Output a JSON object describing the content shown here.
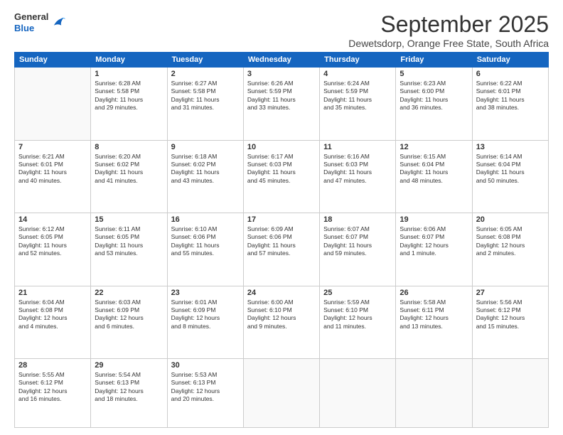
{
  "logo": {
    "general": "General",
    "blue": "Blue"
  },
  "title": "September 2025",
  "subtitle": "Dewetsdorp, Orange Free State, South Africa",
  "weekdays": [
    "Sunday",
    "Monday",
    "Tuesday",
    "Wednesday",
    "Thursday",
    "Friday",
    "Saturday"
  ],
  "weeks": [
    [
      {
        "day": "",
        "text": ""
      },
      {
        "day": "1",
        "text": "Sunrise: 6:28 AM\nSunset: 5:58 PM\nDaylight: 11 hours\nand 29 minutes."
      },
      {
        "day": "2",
        "text": "Sunrise: 6:27 AM\nSunset: 5:58 PM\nDaylight: 11 hours\nand 31 minutes."
      },
      {
        "day": "3",
        "text": "Sunrise: 6:26 AM\nSunset: 5:59 PM\nDaylight: 11 hours\nand 33 minutes."
      },
      {
        "day": "4",
        "text": "Sunrise: 6:24 AM\nSunset: 5:59 PM\nDaylight: 11 hours\nand 35 minutes."
      },
      {
        "day": "5",
        "text": "Sunrise: 6:23 AM\nSunset: 6:00 PM\nDaylight: 11 hours\nand 36 minutes."
      },
      {
        "day": "6",
        "text": "Sunrise: 6:22 AM\nSunset: 6:01 PM\nDaylight: 11 hours\nand 38 minutes."
      }
    ],
    [
      {
        "day": "7",
        "text": "Sunrise: 6:21 AM\nSunset: 6:01 PM\nDaylight: 11 hours\nand 40 minutes."
      },
      {
        "day": "8",
        "text": "Sunrise: 6:20 AM\nSunset: 6:02 PM\nDaylight: 11 hours\nand 41 minutes."
      },
      {
        "day": "9",
        "text": "Sunrise: 6:18 AM\nSunset: 6:02 PM\nDaylight: 11 hours\nand 43 minutes."
      },
      {
        "day": "10",
        "text": "Sunrise: 6:17 AM\nSunset: 6:03 PM\nDaylight: 11 hours\nand 45 minutes."
      },
      {
        "day": "11",
        "text": "Sunrise: 6:16 AM\nSunset: 6:03 PM\nDaylight: 11 hours\nand 47 minutes."
      },
      {
        "day": "12",
        "text": "Sunrise: 6:15 AM\nSunset: 6:04 PM\nDaylight: 11 hours\nand 48 minutes."
      },
      {
        "day": "13",
        "text": "Sunrise: 6:14 AM\nSunset: 6:04 PM\nDaylight: 11 hours\nand 50 minutes."
      }
    ],
    [
      {
        "day": "14",
        "text": "Sunrise: 6:12 AM\nSunset: 6:05 PM\nDaylight: 11 hours\nand 52 minutes."
      },
      {
        "day": "15",
        "text": "Sunrise: 6:11 AM\nSunset: 6:05 PM\nDaylight: 11 hours\nand 53 minutes."
      },
      {
        "day": "16",
        "text": "Sunrise: 6:10 AM\nSunset: 6:06 PM\nDaylight: 11 hours\nand 55 minutes."
      },
      {
        "day": "17",
        "text": "Sunrise: 6:09 AM\nSunset: 6:06 PM\nDaylight: 11 hours\nand 57 minutes."
      },
      {
        "day": "18",
        "text": "Sunrise: 6:07 AM\nSunset: 6:07 PM\nDaylight: 11 hours\nand 59 minutes."
      },
      {
        "day": "19",
        "text": "Sunrise: 6:06 AM\nSunset: 6:07 PM\nDaylight: 12 hours\nand 1 minute."
      },
      {
        "day": "20",
        "text": "Sunrise: 6:05 AM\nSunset: 6:08 PM\nDaylight: 12 hours\nand 2 minutes."
      }
    ],
    [
      {
        "day": "21",
        "text": "Sunrise: 6:04 AM\nSunset: 6:08 PM\nDaylight: 12 hours\nand 4 minutes."
      },
      {
        "day": "22",
        "text": "Sunrise: 6:03 AM\nSunset: 6:09 PM\nDaylight: 12 hours\nand 6 minutes."
      },
      {
        "day": "23",
        "text": "Sunrise: 6:01 AM\nSunset: 6:09 PM\nDaylight: 12 hours\nand 8 minutes."
      },
      {
        "day": "24",
        "text": "Sunrise: 6:00 AM\nSunset: 6:10 PM\nDaylight: 12 hours\nand 9 minutes."
      },
      {
        "day": "25",
        "text": "Sunrise: 5:59 AM\nSunset: 6:10 PM\nDaylight: 12 hours\nand 11 minutes."
      },
      {
        "day": "26",
        "text": "Sunrise: 5:58 AM\nSunset: 6:11 PM\nDaylight: 12 hours\nand 13 minutes."
      },
      {
        "day": "27",
        "text": "Sunrise: 5:56 AM\nSunset: 6:12 PM\nDaylight: 12 hours\nand 15 minutes."
      }
    ],
    [
      {
        "day": "28",
        "text": "Sunrise: 5:55 AM\nSunset: 6:12 PM\nDaylight: 12 hours\nand 16 minutes."
      },
      {
        "day": "29",
        "text": "Sunrise: 5:54 AM\nSunset: 6:13 PM\nDaylight: 12 hours\nand 18 minutes."
      },
      {
        "day": "30",
        "text": "Sunrise: 5:53 AM\nSunset: 6:13 PM\nDaylight: 12 hours\nand 20 minutes."
      },
      {
        "day": "",
        "text": ""
      },
      {
        "day": "",
        "text": ""
      },
      {
        "day": "",
        "text": ""
      },
      {
        "day": "",
        "text": ""
      }
    ]
  ]
}
